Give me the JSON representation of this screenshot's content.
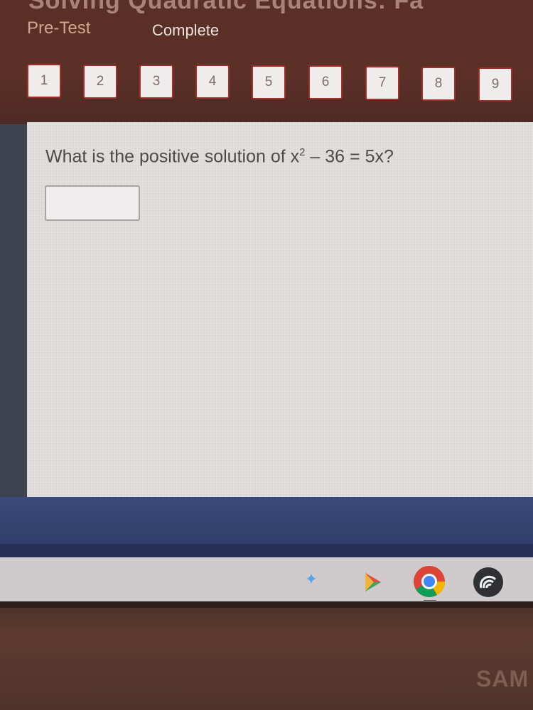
{
  "header": {
    "cut_title": "Solving Quadratic Equations: Fa",
    "tabs": {
      "pretest": "Pre-Test",
      "complete": "Complete"
    }
  },
  "question_nav": {
    "items": [
      "1",
      "2",
      "3",
      "4",
      "5",
      "6",
      "7",
      "8",
      "9"
    ]
  },
  "question": {
    "prefix": "What is the positive solution of ",
    "var": "x",
    "exponent": "2",
    "suffix": " – 36 = 5x?"
  },
  "answer": {
    "value": ""
  },
  "device": {
    "brand": "SAM"
  },
  "colors": {
    "header_bg": "#5a2f26",
    "nav_border": "#a12f2b",
    "panel_bg": "#e3e1e0",
    "blue_band": "#34447a"
  },
  "icons": [
    "assistant-icon",
    "play-store-icon",
    "chrome-icon",
    "launcher-icon"
  ]
}
